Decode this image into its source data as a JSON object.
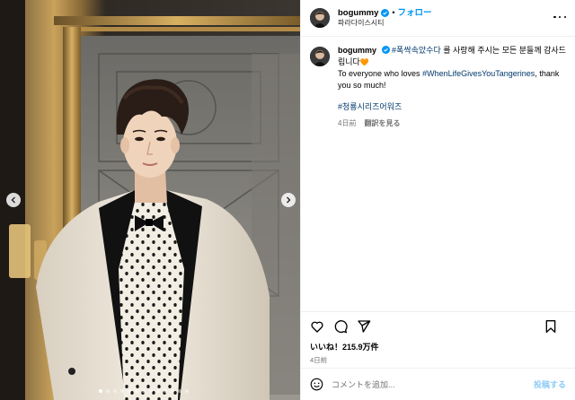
{
  "post": {
    "username": "bogummy",
    "separator": "•",
    "follow_label": "フォロー",
    "location": "파라다이스시티",
    "caption": {
      "username": "bogummy",
      "hashtag1": "#폭싹속았수다",
      "text1": " 를 사랑해 주시는 모든 분들께 감사드립니다",
      "heart_emoji": "🧡",
      "text2": "To everyone who loves ",
      "hashtag2": "#WhenLifeGivesYouTangerines",
      "text3": ", thank you so much!",
      "hashtag3": "#청룡시리즈어워즈",
      "age": "4日前",
      "translate_label": "翻訳を見る"
    },
    "likes_label": "いいね！215.9万件",
    "date_label": "4日前",
    "comment": {
      "placeholder": "コメントを追加...",
      "post_label": "投稿する"
    }
  },
  "carousel": {
    "total_dots": 13,
    "active_index": 0
  },
  "colors": {
    "accent": "#0095f6",
    "link": "#00376b",
    "muted": "#737373",
    "heart": "#ff8a1e"
  },
  "icons": {
    "prev": "chevron-left-icon",
    "next": "chevron-right-icon",
    "like": "heart-icon",
    "comment": "comment-icon",
    "share": "send-icon",
    "save": "bookmark-icon",
    "emoji": "smiley-icon",
    "more": "more-icon"
  }
}
